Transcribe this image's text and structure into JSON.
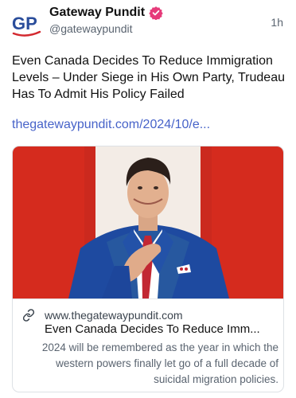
{
  "post": {
    "author_name": "Gateway Pundit",
    "author_handle": "@gatewaypundit",
    "avatar_text": "GP",
    "timestamp": "1h",
    "text": "Even Canada Decides To Reduce Immigration Levels – Under Siege in His Own Party, Trudeau Has To Admit His Policy Failed",
    "link_text": "thegatewaypundit.com/2024/10/e...",
    "verified_icon": "verified-badge-icon",
    "colors": {
      "avatar_blue": "#2a4d9b",
      "avatar_red": "#d3292f",
      "verified_pink": "#e63b7a",
      "link": "#4763c9",
      "flag_red": "#d52b1e"
    }
  },
  "card": {
    "domain": "www.thegatewaypundit.com",
    "title": "Even Canada Decides To Reduce Imm...",
    "description": "2024 will be remembered as the year in which the western powers finally let go of a full decade of suicidal migration policies.",
    "link_icon": "link-chain-icon",
    "image_alt": "photo-of-man-in-blue-suit-with-hand-on-chest-before-red-and-white-backdrop"
  }
}
